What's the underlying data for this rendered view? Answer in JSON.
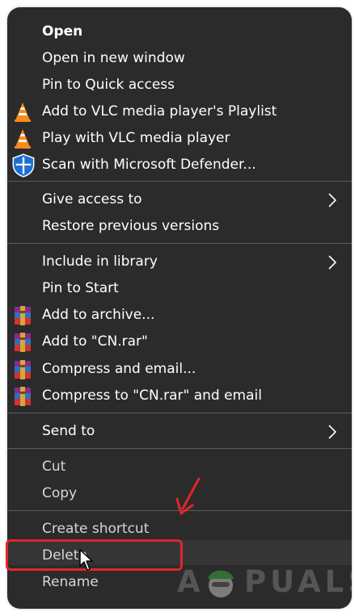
{
  "menu": {
    "group1": [
      {
        "label": "Open",
        "icon": null,
        "bold": true
      },
      {
        "label": "Open in new window",
        "icon": null
      },
      {
        "label": "Pin to Quick access",
        "icon": null
      },
      {
        "label": "Add to VLC media player's Playlist",
        "icon": "vlc-cone-icon"
      },
      {
        "label": "Play with VLC media player",
        "icon": "vlc-cone-icon"
      },
      {
        "label": "Scan with Microsoft Defender...",
        "icon": "defender-shield-icon"
      }
    ],
    "group2": [
      {
        "label": "Give access to",
        "submenu": true
      },
      {
        "label": "Restore previous versions"
      }
    ],
    "group3": [
      {
        "label": "Include in library",
        "submenu": true
      },
      {
        "label": "Pin to Start"
      },
      {
        "label": "Add to archive...",
        "icon": "winrar-icon"
      },
      {
        "label": "Add to \"CN.rar\"",
        "icon": "winrar-icon"
      },
      {
        "label": "Compress and email...",
        "icon": "winrar-icon"
      },
      {
        "label": "Compress to \"CN.rar\" and email",
        "icon": "winrar-icon"
      }
    ],
    "group4": [
      {
        "label": "Send to",
        "submenu": true
      }
    ],
    "group5": [
      {
        "label": "Cut"
      },
      {
        "label": "Copy"
      }
    ],
    "group6": [
      {
        "label": "Create shortcut"
      },
      {
        "label": "Delete",
        "highlighted": true
      },
      {
        "label": "Rename"
      }
    ]
  },
  "watermark": {
    "text_before": "A",
    "text_after": "PUALS"
  },
  "colors": {
    "menu_bg": "#2b2b2b",
    "separator": "#5b5b5b",
    "highlight": "#e3242b",
    "text": "#ffffff"
  }
}
